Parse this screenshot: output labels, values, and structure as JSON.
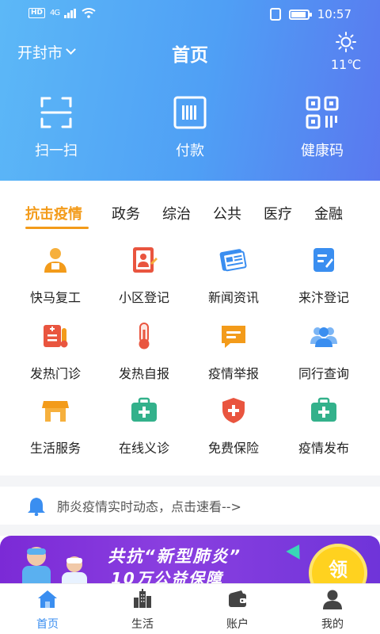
{
  "status": {
    "hd": "HD",
    "signal": "4G",
    "time": "10:57"
  },
  "header": {
    "city": "开封市",
    "title": "首页",
    "temperature": "11℃"
  },
  "quick_actions": [
    {
      "label": "扫一扫",
      "icon": "scan-icon"
    },
    {
      "label": "付款",
      "icon": "payment-code-icon"
    },
    {
      "label": "健康码",
      "icon": "qr-code-icon"
    }
  ],
  "tabs": [
    {
      "label": "抗击疫情",
      "active": true
    },
    {
      "label": "政务"
    },
    {
      "label": "综治"
    },
    {
      "label": "公共"
    },
    {
      "label": "医疗"
    },
    {
      "label": "金融"
    }
  ],
  "grid": [
    {
      "label": "快马复工",
      "icon": "worker-icon"
    },
    {
      "label": "小区登记",
      "icon": "register-icon"
    },
    {
      "label": "新闻资讯",
      "icon": "news-icon"
    },
    {
      "label": "来汴登记",
      "icon": "form-icon"
    },
    {
      "label": "发热门诊",
      "icon": "clinic-icon"
    },
    {
      "label": "发热自报",
      "icon": "thermometer-icon"
    },
    {
      "label": "疫情举报",
      "icon": "report-icon"
    },
    {
      "label": "同行查询",
      "icon": "group-icon"
    },
    {
      "label": "生活服务",
      "icon": "shop-icon"
    },
    {
      "label": "在线义诊",
      "icon": "medkit-icon"
    },
    {
      "label": "免费保险",
      "icon": "shield-icon"
    },
    {
      "label": "疫情发布",
      "icon": "medkit-icon"
    }
  ],
  "notice": {
    "text": "肺炎疫情实时动态，点击速看-->"
  },
  "banner": {
    "line1": "共抗“新型肺炎”",
    "line2": "10万公益保障",
    "badge": "领"
  },
  "bottom_nav": [
    {
      "label": "首页",
      "active": true
    },
    {
      "label": "生活"
    },
    {
      "label": "账户"
    },
    {
      "label": "我的"
    }
  ],
  "colors": {
    "accent": "#f39b1a",
    "header_start": "#5cb8f7",
    "header_end": "#5a78ef",
    "nav_active": "#3a8ef0"
  }
}
